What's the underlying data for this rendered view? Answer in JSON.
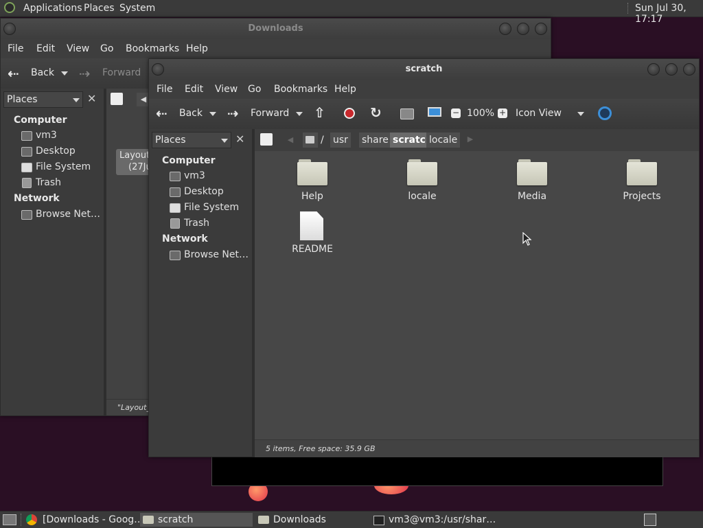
{
  "top_panel": {
    "menus": [
      "Applications",
      "Places",
      "System"
    ],
    "clock": "Sun Jul 30, 17:17"
  },
  "downloads_window": {
    "title": "Downloads",
    "menu": [
      "File",
      "Edit",
      "View",
      "Go",
      "Bookmarks",
      "Help"
    ],
    "back_label": "Back",
    "forward_label": "Forward",
    "places_label": "Places",
    "sidebar": {
      "computer_heading": "Computer",
      "items": [
        "vm3",
        "Desktop",
        "File System",
        "Trash"
      ],
      "network_heading": "Network",
      "network_items": [
        "Browse Net…"
      ]
    },
    "partial_file_line1": "Layout_",
    "partial_file_line2": "(27Ju",
    "status_partial": "\"Layout_l"
  },
  "scratch_window": {
    "title": "scratch",
    "menu": [
      "File",
      "Edit",
      "View",
      "Go",
      "Bookmarks",
      "Help"
    ],
    "back_label": "Back",
    "forward_label": "Forward",
    "zoom": "100%",
    "view_mode": "Icon View",
    "places_label": "Places",
    "breadcrumb": [
      "/",
      "usr",
      "share",
      "scratch",
      "locale"
    ],
    "active_crumb": "scratch",
    "sidebar": {
      "computer_heading": "Computer",
      "items": [
        "vm3",
        "Desktop",
        "File System",
        "Trash"
      ],
      "network_heading": "Network",
      "network_items": [
        "Browse Net…"
      ]
    },
    "files": [
      {
        "name": "Help",
        "type": "folder"
      },
      {
        "name": "locale",
        "type": "folder"
      },
      {
        "name": "Media",
        "type": "folder"
      },
      {
        "name": "Projects",
        "type": "folder"
      },
      {
        "name": "README",
        "type": "file"
      }
    ],
    "status": "5 items, Free space: 35.9 GB"
  },
  "taskbar": {
    "tasks": [
      "[Downloads - Goog…",
      "scratch",
      "Downloads",
      "vm3@vm3:/usr/shar…"
    ]
  },
  "icons": {
    "stop_color": "#c8282c",
    "accent": "#3c8fd8"
  }
}
